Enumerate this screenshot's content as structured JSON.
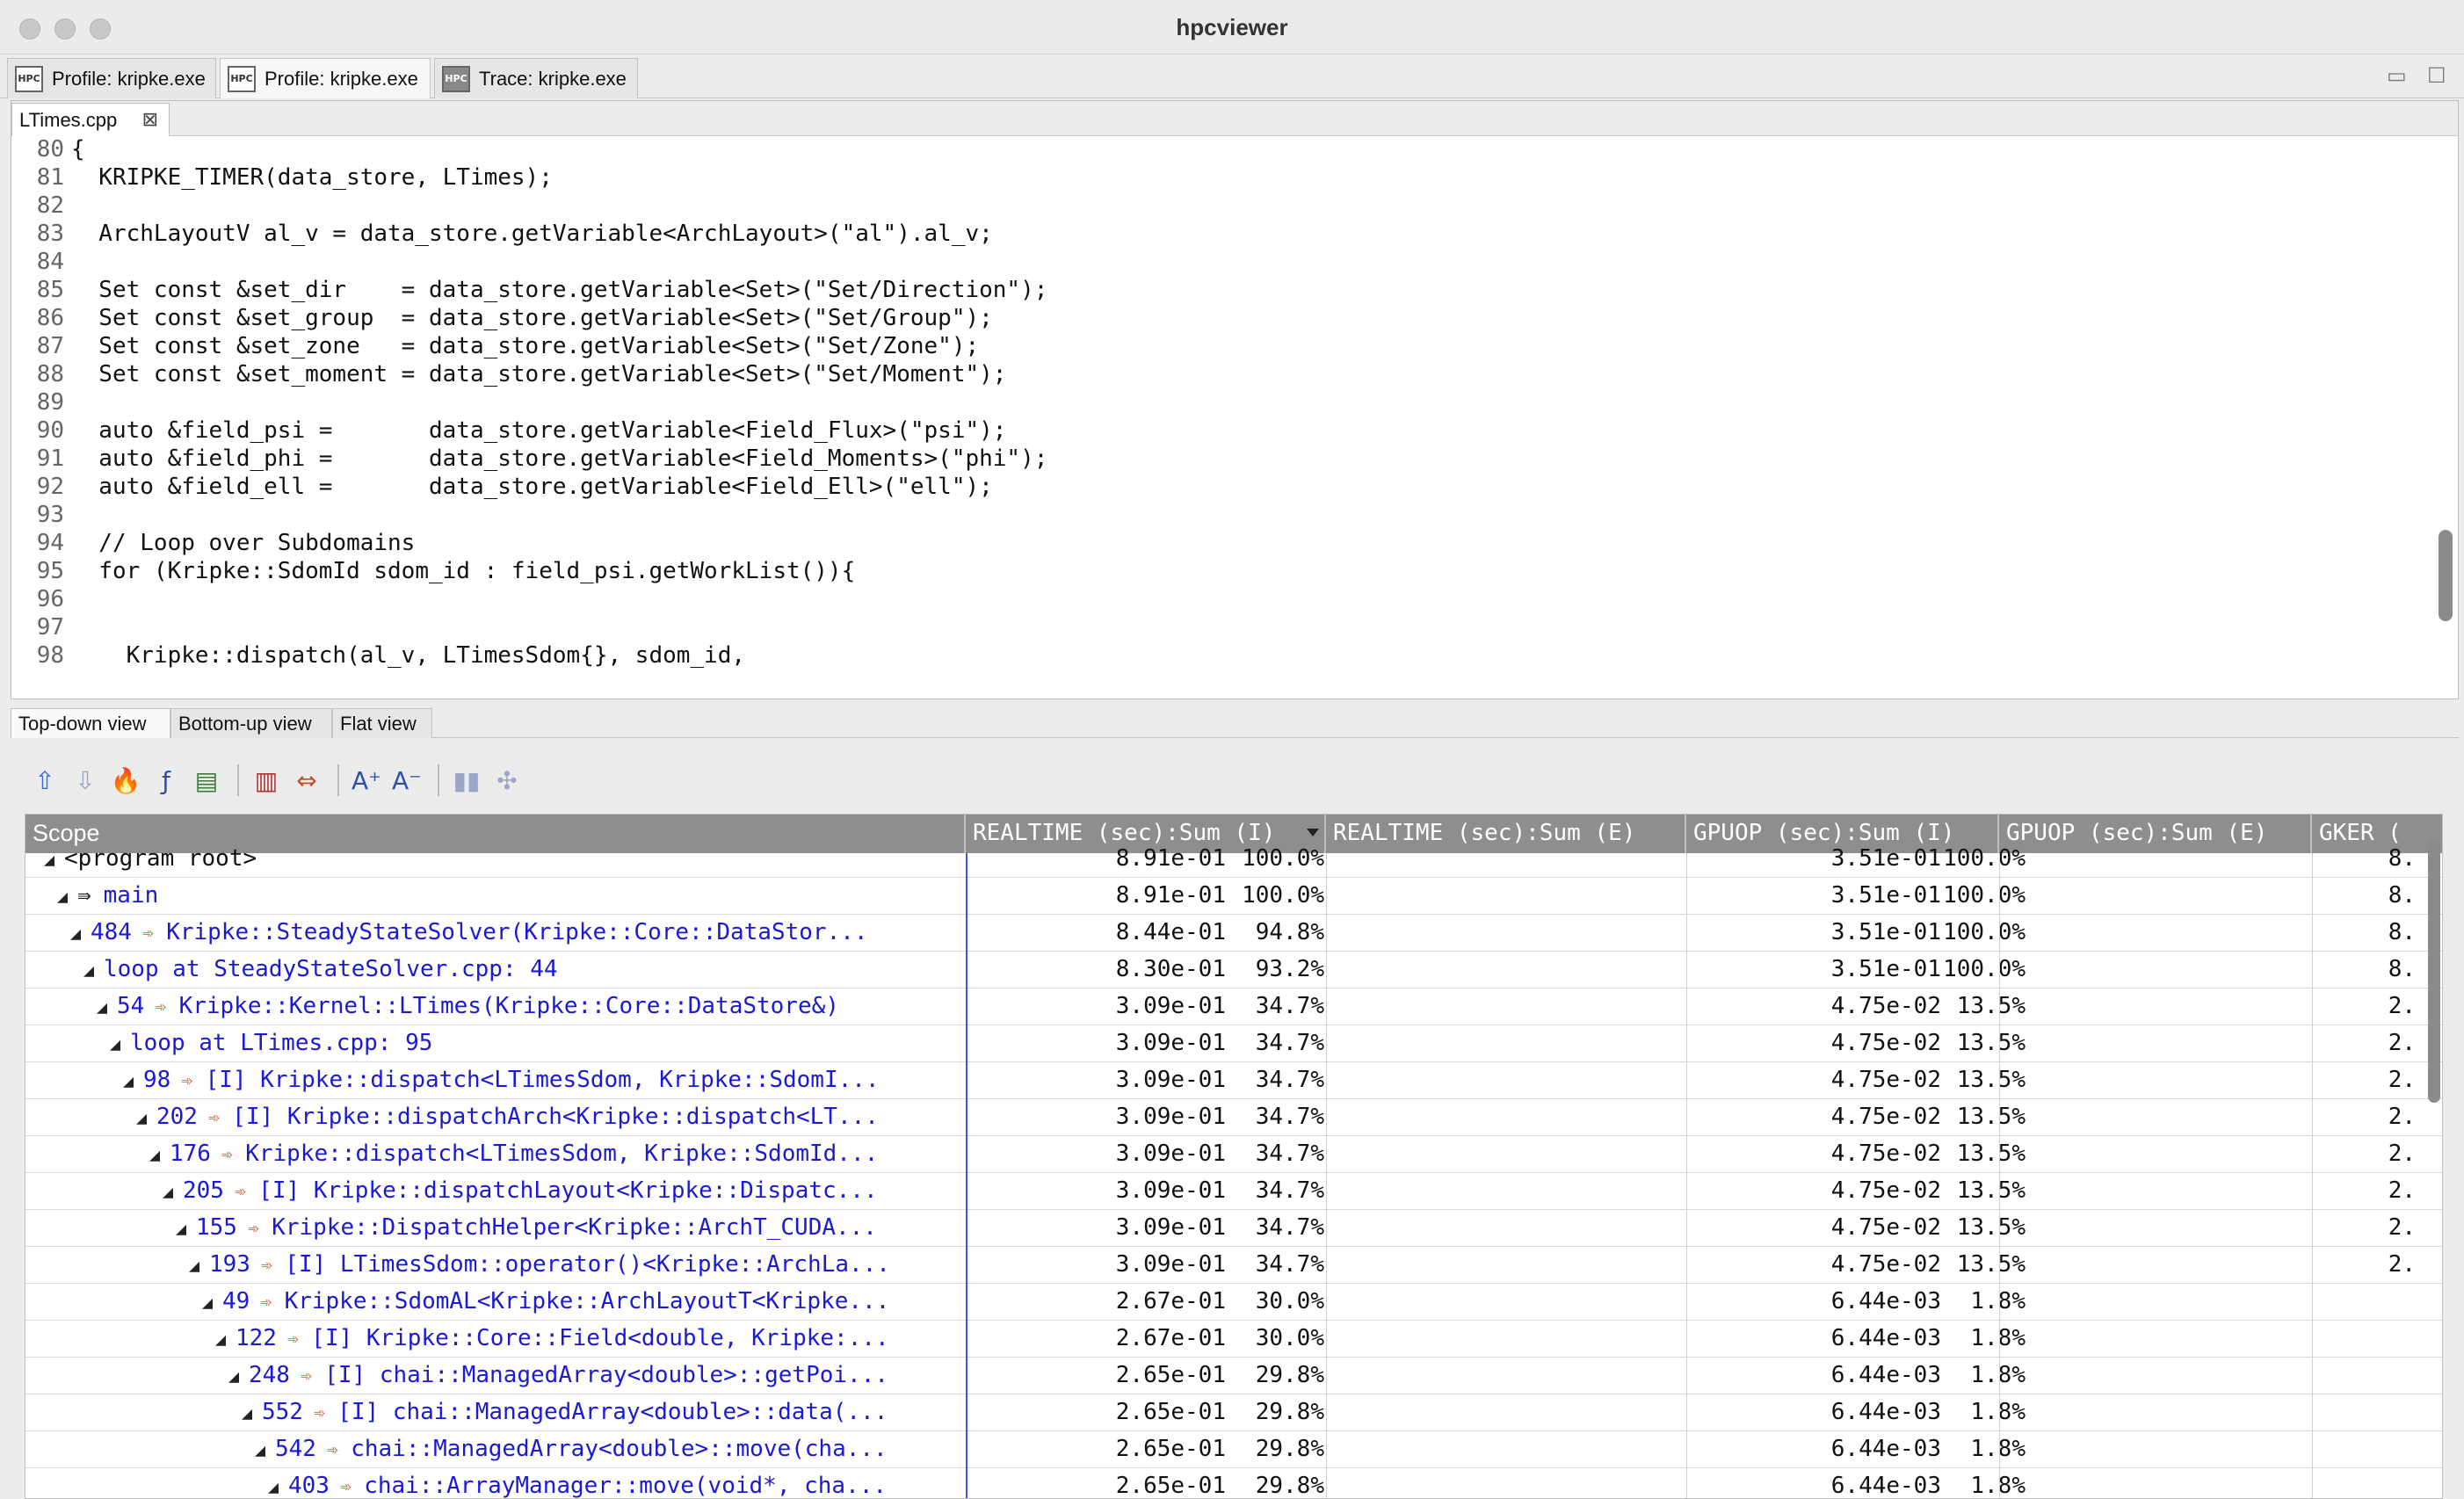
{
  "window": {
    "title": "hpcviewer"
  },
  "perspective_tabs": [
    {
      "label": "Profile: kripke.exe",
      "icon": "hpc-profile-icon",
      "icon_text": "HPC"
    },
    {
      "label": "Profile: kripke.exe",
      "icon": "hpc-profile-icon",
      "icon_text": "HPC"
    },
    {
      "label": "Trace: kripke.exe",
      "icon": "hpc-trace-icon",
      "icon_text": "HPC"
    }
  ],
  "window_controls": {
    "minimize": "▭",
    "maximize": "☐"
  },
  "editor": {
    "tab_label": "LTimes.cpp",
    "close_glyph": "⊠",
    "lines": [
      {
        "n": "80",
        "text": "{"
      },
      {
        "n": "81",
        "text": "  KRIPKE_TIMER(data_store, LTimes);"
      },
      {
        "n": "82",
        "text": ""
      },
      {
        "n": "83",
        "text": "  ArchLayoutV al_v = data_store.getVariable<ArchLayout>(\"al\").al_v;"
      },
      {
        "n": "84",
        "text": ""
      },
      {
        "n": "85",
        "text": "  Set const &set_dir    = data_store.getVariable<Set>(\"Set/Direction\");"
      },
      {
        "n": "86",
        "text": "  Set const &set_group  = data_store.getVariable<Set>(\"Set/Group\");"
      },
      {
        "n": "87",
        "text": "  Set const &set_zone   = data_store.getVariable<Set>(\"Set/Zone\");"
      },
      {
        "n": "88",
        "text": "  Set const &set_moment = data_store.getVariable<Set>(\"Set/Moment\");"
      },
      {
        "n": "89",
        "text": ""
      },
      {
        "n": "90",
        "text": "  auto &field_psi =       data_store.getVariable<Field_Flux>(\"psi\");"
      },
      {
        "n": "91",
        "text": "  auto &field_phi =       data_store.getVariable<Field_Moments>(\"phi\");"
      },
      {
        "n": "92",
        "text": "  auto &field_ell =       data_store.getVariable<Field_Ell>(\"ell\");"
      },
      {
        "n": "93",
        "text": ""
      },
      {
        "n": "94",
        "text": "  // Loop over Subdomains"
      },
      {
        "n": "95",
        "text": "  for (Kripke::SdomId sdom_id : field_psi.getWorkList()){"
      },
      {
        "n": "96",
        "text": ""
      },
      {
        "n": "97",
        "text": ""
      },
      {
        "n": "98",
        "text": "    Kripke::dispatch(al_v, LTimesSdom{}, sdom_id,"
      }
    ]
  },
  "view_tabs": [
    "Top-down view",
    "Bottom-up view",
    "Flat view"
  ],
  "toolbar": {
    "buttons": [
      {
        "name": "zoom-in-icon",
        "glyph": "⇧",
        "color": "#3a6fd0",
        "enabled": true
      },
      {
        "name": "zoom-out-icon",
        "glyph": "⇩",
        "color": "#9aa7c6",
        "enabled": false
      },
      {
        "name": "hot-path-icon",
        "glyph": "🔥",
        "color": "#e0401a",
        "enabled": true
      },
      {
        "name": "derived-metric-icon",
        "glyph": "ƒ",
        "color": "#2c4fa8",
        "enabled": true
      },
      {
        "name": "export-csv-icon",
        "glyph": "▤",
        "color": "#3a7a3a",
        "enabled": true
      },
      {
        "name": "column-select-icon",
        "glyph": "▥",
        "color": "#b03030",
        "enabled": true
      },
      {
        "name": "resize-columns-icon",
        "glyph": "⇔",
        "color": "#c0502a",
        "enabled": true
      },
      {
        "name": "font-increase-icon",
        "glyph": "A⁺",
        "color": "#2c4fa8",
        "enabled": true
      },
      {
        "name": "font-decrease-icon",
        "glyph": "A⁻",
        "color": "#2c4fa8",
        "enabled": true
      },
      {
        "name": "graph-icon",
        "glyph": "▮▮",
        "color": "#9aa7c6",
        "enabled": false
      },
      {
        "name": "thread-view-icon",
        "glyph": "✣",
        "color": "#9aa7c6",
        "enabled": false
      }
    ]
  },
  "table": {
    "columns": [
      "Scope",
      "REALTIME (sec):Sum (I)",
      "REALTIME (sec):Sum (E)",
      "GPUOP (sec):Sum (I)",
      "GPUOP (sec):Sum (E)",
      "GKER ("
    ],
    "rows": [
      {
        "depth": 0,
        "callsite": "",
        "line": "",
        "name": "<program root>",
        "rt_val": "8.91e-01",
        "rt_pct": "100.0%",
        "gpu_val": "3.51e-01",
        "gpu_pct": "100.0%",
        "gker": "8.",
        "scope_color": "#111111"
      },
      {
        "depth": 1,
        "callsite": "⇛",
        "line": "",
        "name": "main",
        "rt_val": "8.91e-01",
        "rt_pct": "100.0%",
        "gpu_val": "3.51e-01",
        "gpu_pct": "100.0%",
        "gker": "8.",
        "scope_color": "#1a1ad6"
      },
      {
        "depth": 2,
        "callsite": "",
        "line": "484",
        "name": "Kripke::SteadyStateSolver(Kripke::Core::DataStor...",
        "rt_val": "8.44e-01",
        "rt_pct": "94.8%",
        "gpu_val": "3.51e-01",
        "gpu_pct": "100.0%",
        "gker": "8.",
        "scope_color": "#1a1ad6"
      },
      {
        "depth": 3,
        "callsite": "",
        "line": "",
        "name": "loop at SteadyStateSolver.cpp: 44",
        "rt_val": "8.30e-01",
        "rt_pct": "93.2%",
        "gpu_val": "3.51e-01",
        "gpu_pct": "100.0%",
        "gker": "8.",
        "scope_color": "#1a1ad6"
      },
      {
        "depth": 4,
        "callsite": "",
        "line": "54",
        "name": "Kripke::Kernel::LTimes(Kripke::Core::DataStore&)",
        "rt_val": "3.09e-01",
        "rt_pct": "34.7%",
        "gpu_val": "4.75e-02",
        "gpu_pct": "13.5%",
        "gker": "2.",
        "scope_color": "#1a1ad6"
      },
      {
        "depth": 5,
        "callsite": "",
        "line": "",
        "name": "loop at LTimes.cpp: 95",
        "rt_val": "3.09e-01",
        "rt_pct": "34.7%",
        "gpu_val": "4.75e-02",
        "gpu_pct": "13.5%",
        "gker": "2.",
        "scope_color": "#1a1ad6"
      },
      {
        "depth": 6,
        "callsite": "",
        "line": "98",
        "name": "[I] Kripke::dispatch<LTimesSdom, Kripke::SdomI...",
        "rt_val": "3.09e-01",
        "rt_pct": "34.7%",
        "gpu_val": "4.75e-02",
        "gpu_pct": "13.5%",
        "gker": "2.",
        "scope_color": "#1a1ad6"
      },
      {
        "depth": 7,
        "callsite": "",
        "line": "202",
        "name": "[I] Kripke::dispatchArch<Kripke::dispatch<LT...",
        "rt_val": "3.09e-01",
        "rt_pct": "34.7%",
        "gpu_val": "4.75e-02",
        "gpu_pct": "13.5%",
        "gker": "2.",
        "scope_color": "#1a1ad6"
      },
      {
        "depth": 8,
        "callsite": "",
        "line": "176",
        "name": "Kripke::dispatch<LTimesSdom, Kripke::SdomId...",
        "rt_val": "3.09e-01",
        "rt_pct": "34.7%",
        "gpu_val": "4.75e-02",
        "gpu_pct": "13.5%",
        "gker": "2.",
        "scope_color": "#1a1ad6"
      },
      {
        "depth": 9,
        "callsite": "",
        "line": "205",
        "name": "[I] Kripke::dispatchLayout<Kripke::Dispatc...",
        "rt_val": "3.09e-01",
        "rt_pct": "34.7%",
        "gpu_val": "4.75e-02",
        "gpu_pct": "13.5%",
        "gker": "2.",
        "scope_color": "#1a1ad6"
      },
      {
        "depth": 10,
        "callsite": "",
        "line": "155",
        "name": "Kripke::DispatchHelper<Kripke::ArchT_CUDA...",
        "rt_val": "3.09e-01",
        "rt_pct": "34.7%",
        "gpu_val": "4.75e-02",
        "gpu_pct": "13.5%",
        "gker": "2.",
        "scope_color": "#1a1ad6"
      },
      {
        "depth": 11,
        "callsite": "",
        "line": "193",
        "name": "[I] LTimesSdom::operator()<Kripke::ArchLa...",
        "rt_val": "3.09e-01",
        "rt_pct": "34.7%",
        "gpu_val": "4.75e-02",
        "gpu_pct": "13.5%",
        "gker": "2.",
        "scope_color": "#1a1ad6"
      },
      {
        "depth": 12,
        "callsite": "",
        "line": "49",
        "name": "Kripke::SdomAL<Kripke::ArchLayoutT<Kripke...",
        "rt_val": "2.67e-01",
        "rt_pct": "30.0%",
        "gpu_val": "6.44e-03",
        "gpu_pct": "1.8%",
        "gker": "",
        "scope_color": "#1a1ad6"
      },
      {
        "depth": 13,
        "callsite": "",
        "line": "122",
        "name": "[I] Kripke::Core::Field<double, Kripke:...",
        "rt_val": "2.67e-01",
        "rt_pct": "30.0%",
        "gpu_val": "6.44e-03",
        "gpu_pct": "1.8%",
        "gker": "",
        "scope_color": "#1a1ad6"
      },
      {
        "depth": 14,
        "callsite": "",
        "line": "248",
        "name": "[I] chai::ManagedArray<double>::getPoi...",
        "rt_val": "2.65e-01",
        "rt_pct": "29.8%",
        "gpu_val": "6.44e-03",
        "gpu_pct": "1.8%",
        "gker": "",
        "scope_color": "#1a1ad6"
      },
      {
        "depth": 15,
        "callsite": "",
        "line": "552",
        "name": "[I] chai::ManagedArray<double>::data(...",
        "rt_val": "2.65e-01",
        "rt_pct": "29.8%",
        "gpu_val": "6.44e-03",
        "gpu_pct": "1.8%",
        "gker": "",
        "scope_color": "#1a1ad6"
      },
      {
        "depth": 16,
        "callsite": "",
        "line": "542",
        "name": "chai::ManagedArray<double>::move(cha...",
        "rt_val": "2.65e-01",
        "rt_pct": "29.8%",
        "gpu_val": "6.44e-03",
        "gpu_pct": "1.8%",
        "gker": "",
        "scope_color": "#1a1ad6"
      },
      {
        "depth": 17,
        "callsite": "",
        "line": "403",
        "name": "chai::ArrayManager::move(void*, cha...",
        "rt_val": "2.65e-01",
        "rt_pct": "29.8%",
        "gpu_val": "6.44e-03",
        "gpu_pct": "1.8%",
        "gker": "",
        "scope_color": "#1a1ad6"
      }
    ]
  }
}
